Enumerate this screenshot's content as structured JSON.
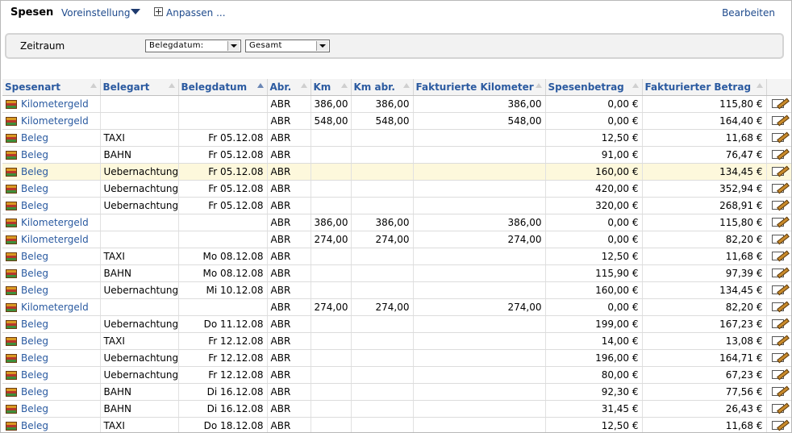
{
  "header": {
    "title": "Spesen",
    "preset": "Voreinstellung",
    "customize": "Anpassen ...",
    "edit": "Bearbeiten"
  },
  "filter": {
    "label": "Zeitraum",
    "date_field": "Belegdatum:",
    "range": "Gesamt"
  },
  "table": {
    "columns": [
      "Spesenart",
      "Belegart",
      "Belegdatum",
      "Abr.",
      "Km",
      "Km abr.",
      "Fakturierte Kilometer",
      "Spesenbetrag",
      "Fakturierter Betrag"
    ],
    "rows": [
      [
        "Kilometergeld",
        "",
        "",
        "ABR",
        "386,00",
        "386,00",
        "386,00",
        "0,00 €",
        "115,80 €"
      ],
      [
        "Kilometergeld",
        "",
        "",
        "ABR",
        "548,00",
        "548,00",
        "548,00",
        "0,00 €",
        "164,40 €"
      ],
      [
        "Beleg",
        "TAXI",
        "Fr 05.12.08",
        "ABR",
        "",
        "",
        "",
        "12,50 €",
        "11,68 €"
      ],
      [
        "Beleg",
        "BAHN",
        "Fr 05.12.08",
        "ABR",
        "",
        "",
        "",
        "91,00 €",
        "76,47 €"
      ],
      [
        "Beleg",
        "Uebernachtung",
        "Fr 05.12.08",
        "ABR",
        "",
        "",
        "",
        "160,00 €",
        "134,45 €"
      ],
      [
        "Beleg",
        "Uebernachtung",
        "Fr 05.12.08",
        "ABR",
        "",
        "",
        "",
        "420,00 €",
        "352,94 €"
      ],
      [
        "Beleg",
        "Uebernachtung",
        "Fr 05.12.08",
        "ABR",
        "",
        "",
        "",
        "320,00 €",
        "268,91 €"
      ],
      [
        "Kilometergeld",
        "",
        "",
        "ABR",
        "386,00",
        "386,00",
        "386,00",
        "0,00 €",
        "115,80 €"
      ],
      [
        "Kilometergeld",
        "",
        "",
        "ABR",
        "274,00",
        "274,00",
        "274,00",
        "0,00 €",
        "82,20 €"
      ],
      [
        "Beleg",
        "TAXI",
        "Mo 08.12.08",
        "ABR",
        "",
        "",
        "",
        "12,50 €",
        "11,68 €"
      ],
      [
        "Beleg",
        "BAHN",
        "Mo 08.12.08",
        "ABR",
        "",
        "",
        "",
        "115,90 €",
        "97,39 €"
      ],
      [
        "Beleg",
        "Uebernachtung",
        "Mi 10.12.08",
        "ABR",
        "",
        "",
        "",
        "160,00 €",
        "134,45 €"
      ],
      [
        "Kilometergeld",
        "",
        "",
        "ABR",
        "274,00",
        "274,00",
        "274,00",
        "0,00 €",
        "82,20 €"
      ],
      [
        "Beleg",
        "Uebernachtung",
        "Do 11.12.08",
        "ABR",
        "",
        "",
        "",
        "199,00 €",
        "167,23 €"
      ],
      [
        "Beleg",
        "TAXI",
        "Fr 12.12.08",
        "ABR",
        "",
        "",
        "",
        "14,00 €",
        "13,08 €"
      ],
      [
        "Beleg",
        "Uebernachtung",
        "Fr 12.12.08",
        "ABR",
        "",
        "",
        "",
        "196,00 €",
        "164,71 €"
      ],
      [
        "Beleg",
        "Uebernachtung",
        "Fr 12.12.08",
        "ABR",
        "",
        "",
        "",
        "80,00 €",
        "67,23 €"
      ],
      [
        "Beleg",
        "BAHN",
        "Di 16.12.08",
        "ABR",
        "",
        "",
        "",
        "92,30 €",
        "77,56 €"
      ],
      [
        "Beleg",
        "BAHN",
        "Di 16.12.08",
        "ABR",
        "",
        "",
        "",
        "31,45 €",
        "26,43 €"
      ],
      [
        "Beleg",
        "TAXI",
        "Do 18.12.08",
        "ABR",
        "",
        "",
        "",
        "12,50 €",
        "11,68 €"
      ]
    ],
    "highlighted_row": 4,
    "sorted_column": 2
  },
  "icons": {
    "row": "expense-type-icon",
    "action": "edit-pencil-icon"
  },
  "colors": {
    "link": "#2a5aa0",
    "header_text": "#2b5aa0",
    "highlight_row": "#fdf8dc"
  }
}
